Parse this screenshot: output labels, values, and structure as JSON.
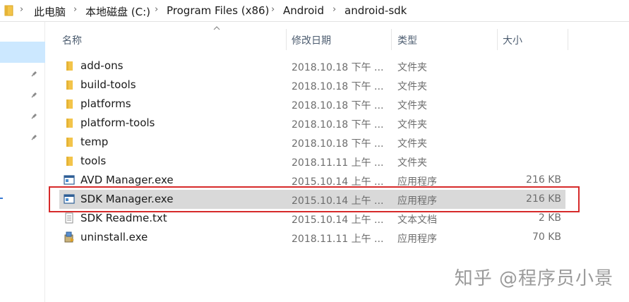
{
  "breadcrumb": [
    "此电脑",
    "本地磁盘 (C:)",
    "Program Files (x86)",
    "Android",
    "android-sdk"
  ],
  "columns": {
    "name": "名称",
    "date": "修改日期",
    "type": "类型",
    "size": "大小"
  },
  "files": [
    {
      "name": "add-ons",
      "date": "2018.10.18 下午 ...",
      "type": "文件夹",
      "size": "",
      "icon": "folder-icon"
    },
    {
      "name": "build-tools",
      "date": "2018.10.18 下午 ...",
      "type": "文件夹",
      "size": "",
      "icon": "folder-icon"
    },
    {
      "name": "platforms",
      "date": "2018.10.18 下午 ...",
      "type": "文件夹",
      "size": "",
      "icon": "folder-icon"
    },
    {
      "name": "platform-tools",
      "date": "2018.10.18 下午 ...",
      "type": "文件夹",
      "size": "",
      "icon": "folder-icon"
    },
    {
      "name": "temp",
      "date": "2018.10.18 下午 ...",
      "type": "文件夹",
      "size": "",
      "icon": "folder-icon"
    },
    {
      "name": "tools",
      "date": "2018.11.11 上午 ...",
      "type": "文件夹",
      "size": "",
      "icon": "folder-icon"
    },
    {
      "name": "AVD Manager.exe",
      "date": "2015.10.14 上午 ...",
      "type": "应用程序",
      "size": "216 KB",
      "icon": "exe-window-icon"
    },
    {
      "name": "SDK Manager.exe",
      "date": "2015.10.14 上午 ...",
      "type": "应用程序",
      "size": "216 KB",
      "icon": "exe-window-icon",
      "selected": true
    },
    {
      "name": "SDK Readme.txt",
      "date": "2015.10.14 上午 ...",
      "type": "文本文档",
      "size": "2 KB",
      "icon": "text-file-icon"
    },
    {
      "name": "uninstall.exe",
      "date": "2018.11.11 上午 ...",
      "type": "应用程序",
      "size": "70 KB",
      "icon": "installer-icon"
    }
  ],
  "watermark": "知乎 @程序员小景",
  "colors": {
    "selection": "#d9d9d9",
    "highlight_border": "#d62a2a",
    "nav_selected": "#cce8ff",
    "folder": "#f3c44a"
  }
}
